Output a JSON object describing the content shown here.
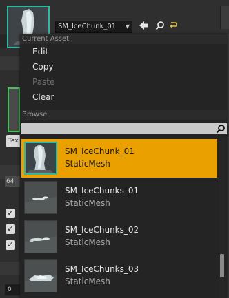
{
  "details": {
    "asset_combo_value": "SM_IceChunk_01",
    "left_labels": {
      "texture_tab": "Tex",
      "resolution": "64",
      "zero_field": "0"
    }
  },
  "popup": {
    "current_asset_header": "Current Asset",
    "menu_items": [
      {
        "label": "Edit",
        "enabled": true
      },
      {
        "label": "Copy",
        "enabled": true
      },
      {
        "label": "Paste",
        "enabled": false
      },
      {
        "label": "Clear",
        "enabled": true
      }
    ],
    "browse_header": "Browse",
    "search": {
      "value": "",
      "placeholder": ""
    },
    "assets": [
      {
        "name": "SM_IceChunk_01",
        "type": "StaticMesh",
        "selected": true
      },
      {
        "name": "SM_IceChunks_01",
        "type": "StaticMesh",
        "selected": false
      },
      {
        "name": "SM_IceChunks_02",
        "type": "StaticMesh",
        "selected": false
      },
      {
        "name": "SM_IceChunks_03",
        "type": "StaticMesh",
        "selected": false
      }
    ],
    "scroll_position": 0.85
  },
  "icons": {
    "combo_chevron": "chevron-down-icon",
    "browse": "arrow-left-icon",
    "find": "search-icon",
    "reset": "reset-arrow-icon",
    "checkbox": "check-icon"
  },
  "colors": {
    "selection": "#eaa100",
    "thumb_highlight": "#2fb9a3",
    "panel": "#242424",
    "search_bg": "#c9c9c9"
  }
}
